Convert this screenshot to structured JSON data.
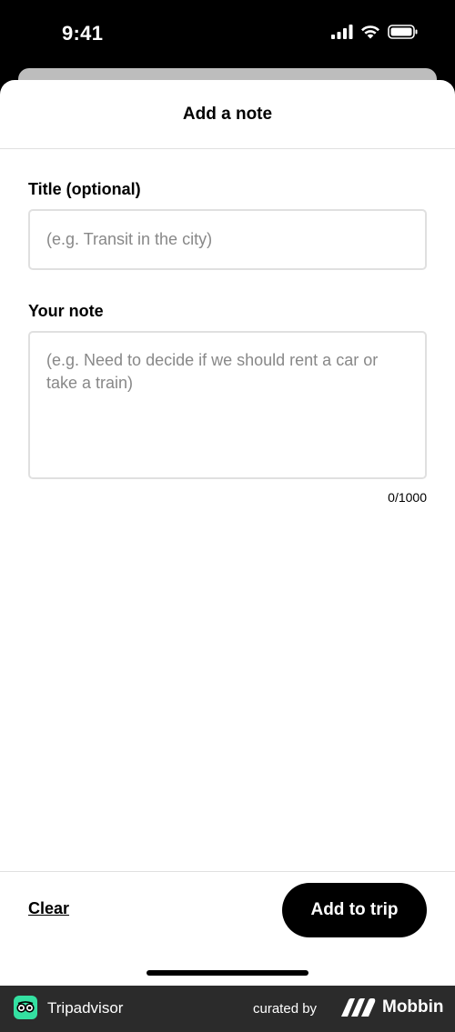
{
  "status_bar": {
    "time": "9:41"
  },
  "sheet": {
    "title": "Add a note",
    "title_field": {
      "label": "Title (optional)",
      "placeholder": "(e.g. Transit in the city)",
      "value": ""
    },
    "note_field": {
      "label": "Your note",
      "placeholder": "(e.g. Need to decide if we should rent a car or take a train)",
      "value": ""
    },
    "char_count": "0/1000"
  },
  "footer": {
    "clear_label": "Clear",
    "add_label": "Add to trip"
  },
  "attribution": {
    "brand": "Tripadvisor",
    "curated_by": "curated by",
    "curator": "Mobbin"
  },
  "colors": {
    "accent": "#000000",
    "brand_green": "#34e0a1",
    "border": "#e0e0e0",
    "placeholder": "#888888"
  }
}
